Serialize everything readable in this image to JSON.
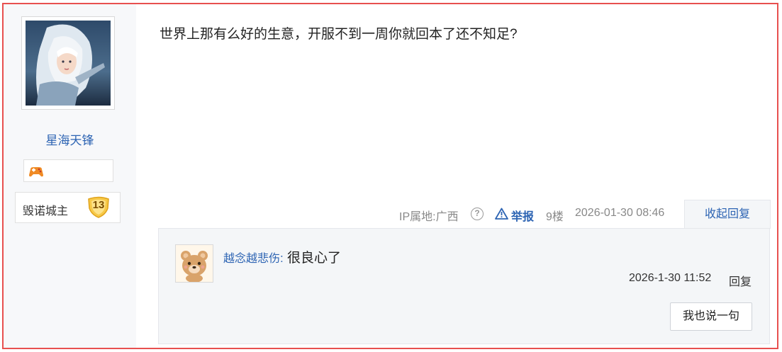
{
  "user": {
    "name": "星海天锋",
    "level_title": "毁诺城主",
    "level": "13"
  },
  "post": {
    "content": "世界上那有么好的生意，开服不到一周你就回本了还不知足?",
    "ip_location": "IP属地:广西",
    "report_label": "举报",
    "floor": "9楼",
    "time": "2026-01-30 08:46",
    "collapse_label": "收起回复"
  },
  "reply": {
    "username": "越念越悲伤",
    "colon": ":",
    "content": " 很良心了",
    "time": "2026-1-30 11:52",
    "reply_label": "回复",
    "say_button": "我也说一句"
  },
  "colors": {
    "border": "#e8504f",
    "link": "#2d64b3",
    "panel": "#f4f6f8"
  }
}
